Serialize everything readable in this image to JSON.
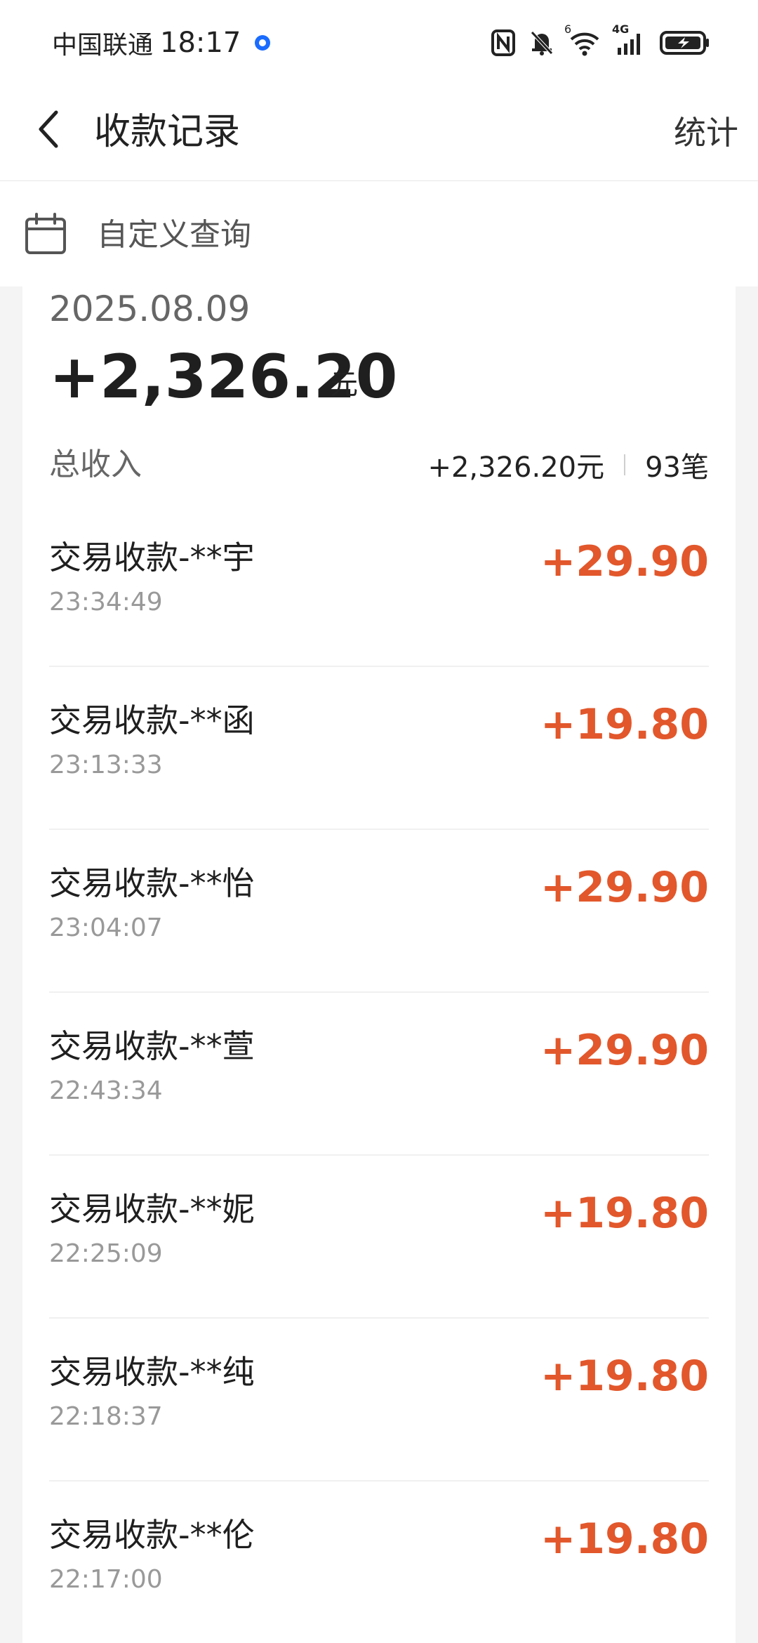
{
  "status_bar": {
    "carrier": "中国联通",
    "time": "18:17",
    "network": "4G",
    "wifi_badge": "6"
  },
  "header": {
    "title": "收款记录",
    "stats_label": "统计"
  },
  "query": {
    "label": "自定义查询"
  },
  "summary": {
    "date": "2025.08.09",
    "total": "+2,326.20",
    "unit": "元",
    "income_label": "总收入",
    "income_amount": "+2,326.20元",
    "count": "93笔"
  },
  "transactions": [
    {
      "title": "交易收款-**宇",
      "time": "23:34:49",
      "amount": "+29.90"
    },
    {
      "title": "交易收款-**函",
      "time": "23:13:33",
      "amount": "+19.80"
    },
    {
      "title": "交易收款-**怡",
      "time": "23:04:07",
      "amount": "+29.90"
    },
    {
      "title": "交易收款-**萱",
      "time": "22:43:34",
      "amount": "+29.90"
    },
    {
      "title": "交易收款-**妮",
      "time": "22:25:09",
      "amount": "+19.80"
    },
    {
      "title": "交易收款-**纯",
      "time": "22:18:37",
      "amount": "+19.80"
    },
    {
      "title": "交易收款-**伦",
      "time": "22:17:00",
      "amount": "+19.80"
    }
  ],
  "colors": {
    "amount": "#e2572b",
    "background": "#f4f4f4",
    "location_dot": "#1a6cff"
  },
  "icons": {
    "back": "chevron-left-icon",
    "calendar": "calendar-icon",
    "nfc": "nfc-icon",
    "mute": "bell-off-icon",
    "wifi": "wifi-icon",
    "signal": "signal-icon",
    "battery": "battery-charging-icon"
  }
}
